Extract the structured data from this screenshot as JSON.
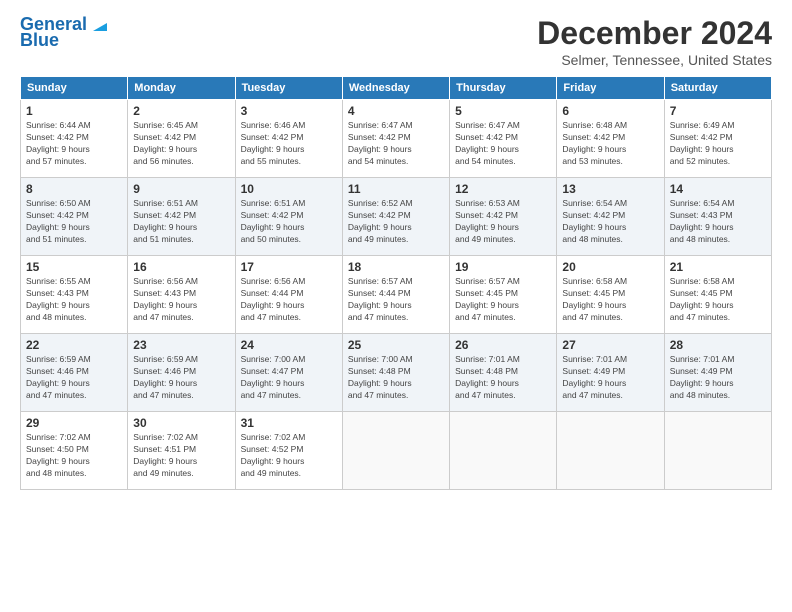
{
  "logo": {
    "line1": "General",
    "line2": "Blue"
  },
  "title": "December 2024",
  "location": "Selmer, Tennessee, United States",
  "days_of_week": [
    "Sunday",
    "Monday",
    "Tuesday",
    "Wednesday",
    "Thursday",
    "Friday",
    "Saturday"
  ],
  "weeks": [
    [
      {
        "day": "1",
        "sunrise": "6:44 AM",
        "sunset": "4:42 PM",
        "daylight": "9 hours and 57 minutes."
      },
      {
        "day": "2",
        "sunrise": "6:45 AM",
        "sunset": "4:42 PM",
        "daylight": "9 hours and 56 minutes."
      },
      {
        "day": "3",
        "sunrise": "6:46 AM",
        "sunset": "4:42 PM",
        "daylight": "9 hours and 55 minutes."
      },
      {
        "day": "4",
        "sunrise": "6:47 AM",
        "sunset": "4:42 PM",
        "daylight": "9 hours and 54 minutes."
      },
      {
        "day": "5",
        "sunrise": "6:47 AM",
        "sunset": "4:42 PM",
        "daylight": "9 hours and 54 minutes."
      },
      {
        "day": "6",
        "sunrise": "6:48 AM",
        "sunset": "4:42 PM",
        "daylight": "9 hours and 53 minutes."
      },
      {
        "day": "7",
        "sunrise": "6:49 AM",
        "sunset": "4:42 PM",
        "daylight": "9 hours and 52 minutes."
      }
    ],
    [
      {
        "day": "8",
        "sunrise": "6:50 AM",
        "sunset": "4:42 PM",
        "daylight": "9 hours and 51 minutes."
      },
      {
        "day": "9",
        "sunrise": "6:51 AM",
        "sunset": "4:42 PM",
        "daylight": "9 hours and 51 minutes."
      },
      {
        "day": "10",
        "sunrise": "6:51 AM",
        "sunset": "4:42 PM",
        "daylight": "9 hours and 50 minutes."
      },
      {
        "day": "11",
        "sunrise": "6:52 AM",
        "sunset": "4:42 PM",
        "daylight": "9 hours and 49 minutes."
      },
      {
        "day": "12",
        "sunrise": "6:53 AM",
        "sunset": "4:42 PM",
        "daylight": "9 hours and 49 minutes."
      },
      {
        "day": "13",
        "sunrise": "6:54 AM",
        "sunset": "4:42 PM",
        "daylight": "9 hours and 48 minutes."
      },
      {
        "day": "14",
        "sunrise": "6:54 AM",
        "sunset": "4:43 PM",
        "daylight": "9 hours and 48 minutes."
      }
    ],
    [
      {
        "day": "15",
        "sunrise": "6:55 AM",
        "sunset": "4:43 PM",
        "daylight": "9 hours and 48 minutes."
      },
      {
        "day": "16",
        "sunrise": "6:56 AM",
        "sunset": "4:43 PM",
        "daylight": "9 hours and 47 minutes."
      },
      {
        "day": "17",
        "sunrise": "6:56 AM",
        "sunset": "4:44 PM",
        "daylight": "9 hours and 47 minutes."
      },
      {
        "day": "18",
        "sunrise": "6:57 AM",
        "sunset": "4:44 PM",
        "daylight": "9 hours and 47 minutes."
      },
      {
        "day": "19",
        "sunrise": "6:57 AM",
        "sunset": "4:45 PM",
        "daylight": "9 hours and 47 minutes."
      },
      {
        "day": "20",
        "sunrise": "6:58 AM",
        "sunset": "4:45 PM",
        "daylight": "9 hours and 47 minutes."
      },
      {
        "day": "21",
        "sunrise": "6:58 AM",
        "sunset": "4:45 PM",
        "daylight": "9 hours and 47 minutes."
      }
    ],
    [
      {
        "day": "22",
        "sunrise": "6:59 AM",
        "sunset": "4:46 PM",
        "daylight": "9 hours and 47 minutes."
      },
      {
        "day": "23",
        "sunrise": "6:59 AM",
        "sunset": "4:46 PM",
        "daylight": "9 hours and 47 minutes."
      },
      {
        "day": "24",
        "sunrise": "7:00 AM",
        "sunset": "4:47 PM",
        "daylight": "9 hours and 47 minutes."
      },
      {
        "day": "25",
        "sunrise": "7:00 AM",
        "sunset": "4:48 PM",
        "daylight": "9 hours and 47 minutes."
      },
      {
        "day": "26",
        "sunrise": "7:01 AM",
        "sunset": "4:48 PM",
        "daylight": "9 hours and 47 minutes."
      },
      {
        "day": "27",
        "sunrise": "7:01 AM",
        "sunset": "4:49 PM",
        "daylight": "9 hours and 47 minutes."
      },
      {
        "day": "28",
        "sunrise": "7:01 AM",
        "sunset": "4:49 PM",
        "daylight": "9 hours and 48 minutes."
      }
    ],
    [
      {
        "day": "29",
        "sunrise": "7:02 AM",
        "sunset": "4:50 PM",
        "daylight": "9 hours and 48 minutes."
      },
      {
        "day": "30",
        "sunrise": "7:02 AM",
        "sunset": "4:51 PM",
        "daylight": "9 hours and 49 minutes."
      },
      {
        "day": "31",
        "sunrise": "7:02 AM",
        "sunset": "4:52 PM",
        "daylight": "9 hours and 49 minutes."
      },
      null,
      null,
      null,
      null
    ]
  ]
}
